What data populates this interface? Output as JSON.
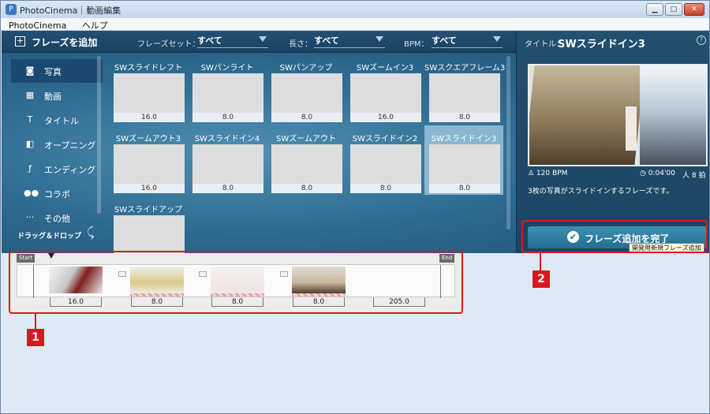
{
  "window": {
    "title": "PhotoCinema｜動画編集",
    "min_label": "▁",
    "max_label": "□",
    "close_label": "✕"
  },
  "menu": [
    "PhotoCinema",
    "ヘルプ"
  ],
  "toolbar": {
    "add_phrase": "フレーズを追加",
    "phrase_set_label": "フレーズセット：",
    "phrase_set_value": "すべて",
    "length_label": "長さ：",
    "length_value": "すべて",
    "bpm_label": "BPM：",
    "bpm_value": "すべて"
  },
  "sidebar": {
    "items": [
      {
        "label": "写真",
        "icon": "camera-icon"
      },
      {
        "label": "動画",
        "icon": "film-icon"
      },
      {
        "label": "タイトル",
        "icon": "title-icon"
      },
      {
        "label": "オープニング",
        "icon": "opening-icon"
      },
      {
        "label": "エンディング",
        "icon": "fin-icon"
      },
      {
        "label": "コラボ",
        "icon": "people-icon"
      },
      {
        "label": "その他",
        "icon": "dots-icon"
      }
    ],
    "drag_hint": "ドラッグ＆ドロップ"
  },
  "phrases": [
    {
      "name": "SWスライドレフト",
      "dur": "16.0"
    },
    {
      "name": "SWパンライト",
      "dur": "8.0"
    },
    {
      "name": "SWパンアップ",
      "dur": "8.0"
    },
    {
      "name": "SWズームイン3",
      "dur": "16.0"
    },
    {
      "name": "SWスクエアフレーム3",
      "dur": "8.0"
    },
    {
      "name": "SWズームアウト3",
      "dur": "16.0"
    },
    {
      "name": "SWスライドイン4",
      "dur": "8.0"
    },
    {
      "name": "SWズームアウト",
      "dur": "8.0"
    },
    {
      "name": "SWスライドイン2",
      "dur": "8.0"
    },
    {
      "name": "SWスライドイン3",
      "dur": "8.0"
    },
    {
      "name": "SWスライドアップ",
      "dur": ""
    }
  ],
  "preview": {
    "title_label": "タイトル：",
    "title": "SWスライドイン3",
    "help": "?",
    "bpm": "120 BPM",
    "time": "0:04'00",
    "count": "8 拍",
    "description": "3枚の写真がスライドインするフレーズです。",
    "done_button": "フレーズ追加を完了",
    "tooltip": "開発用新規フレーズ追加"
  },
  "timeline": {
    "start": "Start",
    "end": "End",
    "durations": [
      "16.0",
      "8.0",
      "8.0",
      "8.0",
      "205.0"
    ]
  },
  "annotations": {
    "one": "1",
    "two": "2"
  },
  "colors": {
    "accent": "#d7191f",
    "panel": "#1c4563",
    "button": "#2f7ea3"
  }
}
